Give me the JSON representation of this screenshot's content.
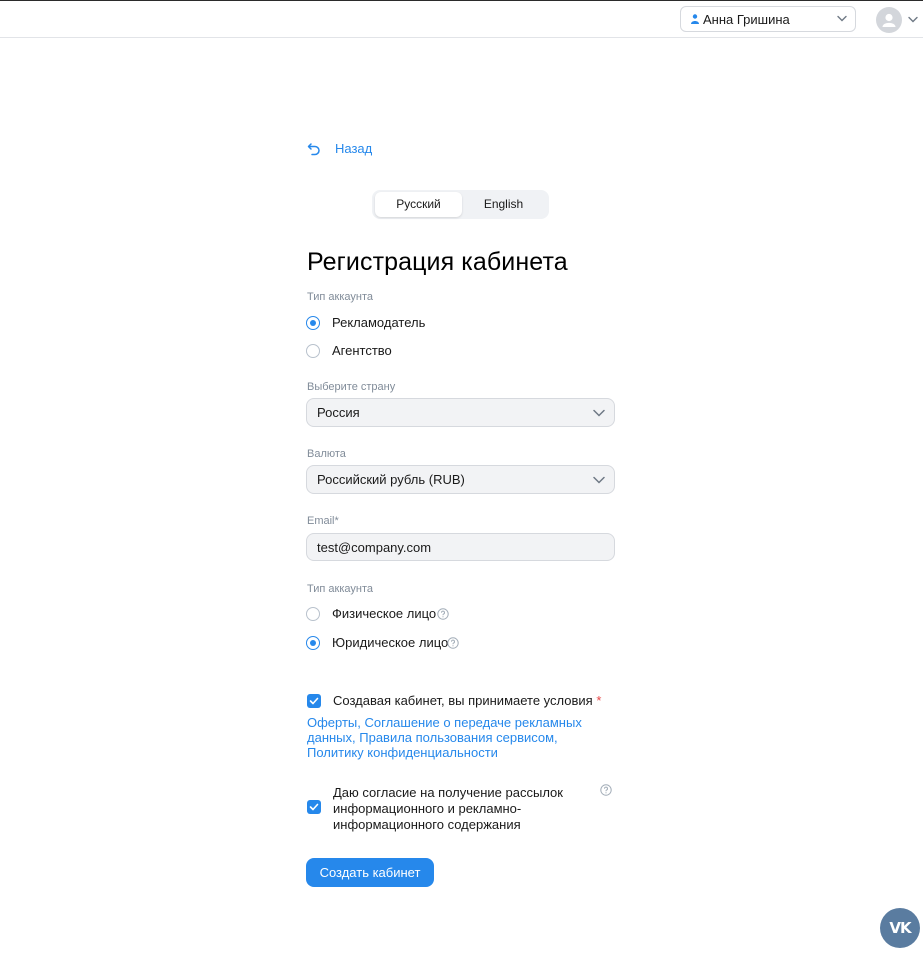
{
  "header": {
    "account_name": "Анна Гришина",
    "icons": [
      "person-icon",
      "chevron-down-icon",
      "avatar-icon"
    ]
  },
  "back": {
    "label": "Назад"
  },
  "language": {
    "options": [
      "Русский",
      "English"
    ],
    "selected": "Русский"
  },
  "form": {
    "title": "Регистрация кабинета",
    "account_type": {
      "label": "Тип аккаунта",
      "options": [
        "Рекламодатель",
        "Агентство"
      ],
      "selected": "Рекламодатель"
    },
    "country": {
      "label": "Выберите страну",
      "value": "Россия"
    },
    "currency": {
      "label": "Валюта",
      "value": "Российский рубль (RUB)"
    },
    "email": {
      "label": "Email*",
      "value": "test@company.com"
    },
    "entity_type": {
      "label": "Тип аккаунта",
      "options": [
        "Физическое лицо",
        "Юридическое лицо"
      ],
      "selected": "Юридическое лицо"
    },
    "terms": {
      "text": "Создавая кабинет, вы принимаете условия",
      "required_mark": "*",
      "checked": true,
      "links": "Оферты, Соглашение о передаче рекламных данных, Правила пользования сервисом, Политику конфиденциальности"
    },
    "newsletter": {
      "line1": "Даю согласие на получение рассылок",
      "line2": "информационного и рекламно-",
      "line3": "информационного содержания",
      "checked": true
    },
    "submit_label": "Создать кабинет"
  },
  "fab": {
    "label": "VK"
  },
  "colors": {
    "accent": "#2688eb",
    "muted": "#818c99",
    "field_bg": "#f2f3f5",
    "fab": "#5a7ca0"
  }
}
